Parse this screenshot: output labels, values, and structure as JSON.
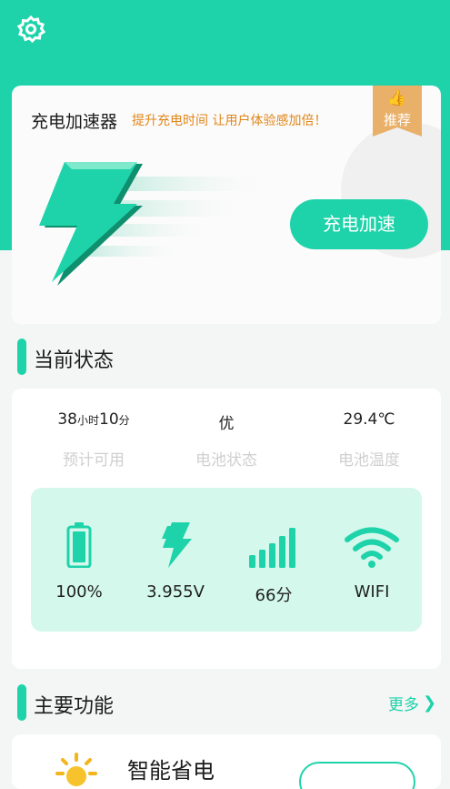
{
  "header": {
    "settings_icon": "gear-icon"
  },
  "hero": {
    "title": "充电加速器",
    "subtitle": "提升充电时间 让用户体验感加倍！",
    "badge_icon": "thumbs-up-icon",
    "badge_label": "推荐",
    "button_label": "充电加速",
    "accent_color": "#1ed3aa",
    "badge_color": "#e9b06a"
  },
  "status_section": {
    "title": "当前状态",
    "stats": [
      {
        "value_num1": "38",
        "value_unit1": "小时",
        "value_num2": "10",
        "value_unit2": "分",
        "label": "预计可用"
      },
      {
        "value": "优",
        "label": "电池状态"
      },
      {
        "value": "29.4℃",
        "label": "电池温度"
      }
    ],
    "metrics": [
      {
        "icon": "battery-icon",
        "value": "100%",
        "level": 1.0
      },
      {
        "icon": "lightning-icon",
        "value": "3.955V"
      },
      {
        "icon": "signal-bars-icon",
        "value": "66分"
      },
      {
        "icon": "wifi-icon",
        "value": "WIFI"
      }
    ]
  },
  "functions_section": {
    "title": "主要功能",
    "more_label": "更多",
    "first_item": {
      "icon": "sun-icon",
      "title": "智能省电"
    }
  }
}
